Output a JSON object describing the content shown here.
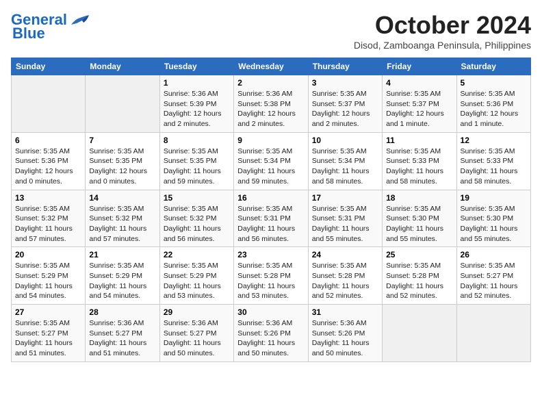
{
  "logo": {
    "general": "General",
    "blue": "Blue"
  },
  "title": "October 2024",
  "subtitle": "Disod, Zamboanga Peninsula, Philippines",
  "headers": [
    "Sunday",
    "Monday",
    "Tuesday",
    "Wednesday",
    "Thursday",
    "Friday",
    "Saturday"
  ],
  "weeks": [
    [
      {
        "day": "",
        "info": ""
      },
      {
        "day": "",
        "info": ""
      },
      {
        "day": "1",
        "info": "Sunrise: 5:36 AM\nSunset: 5:39 PM\nDaylight: 12 hours and 2 minutes."
      },
      {
        "day": "2",
        "info": "Sunrise: 5:36 AM\nSunset: 5:38 PM\nDaylight: 12 hours and 2 minutes."
      },
      {
        "day": "3",
        "info": "Sunrise: 5:35 AM\nSunset: 5:37 PM\nDaylight: 12 hours and 2 minutes."
      },
      {
        "day": "4",
        "info": "Sunrise: 5:35 AM\nSunset: 5:37 PM\nDaylight: 12 hours and 1 minute."
      },
      {
        "day": "5",
        "info": "Sunrise: 5:35 AM\nSunset: 5:36 PM\nDaylight: 12 hours and 1 minute."
      }
    ],
    [
      {
        "day": "6",
        "info": "Sunrise: 5:35 AM\nSunset: 5:36 PM\nDaylight: 12 hours and 0 minutes."
      },
      {
        "day": "7",
        "info": "Sunrise: 5:35 AM\nSunset: 5:35 PM\nDaylight: 12 hours and 0 minutes."
      },
      {
        "day": "8",
        "info": "Sunrise: 5:35 AM\nSunset: 5:35 PM\nDaylight: 11 hours and 59 minutes."
      },
      {
        "day": "9",
        "info": "Sunrise: 5:35 AM\nSunset: 5:34 PM\nDaylight: 11 hours and 59 minutes."
      },
      {
        "day": "10",
        "info": "Sunrise: 5:35 AM\nSunset: 5:34 PM\nDaylight: 11 hours and 58 minutes."
      },
      {
        "day": "11",
        "info": "Sunrise: 5:35 AM\nSunset: 5:33 PM\nDaylight: 11 hours and 58 minutes."
      },
      {
        "day": "12",
        "info": "Sunrise: 5:35 AM\nSunset: 5:33 PM\nDaylight: 11 hours and 58 minutes."
      }
    ],
    [
      {
        "day": "13",
        "info": "Sunrise: 5:35 AM\nSunset: 5:32 PM\nDaylight: 11 hours and 57 minutes."
      },
      {
        "day": "14",
        "info": "Sunrise: 5:35 AM\nSunset: 5:32 PM\nDaylight: 11 hours and 57 minutes."
      },
      {
        "day": "15",
        "info": "Sunrise: 5:35 AM\nSunset: 5:32 PM\nDaylight: 11 hours and 56 minutes."
      },
      {
        "day": "16",
        "info": "Sunrise: 5:35 AM\nSunset: 5:31 PM\nDaylight: 11 hours and 56 minutes."
      },
      {
        "day": "17",
        "info": "Sunrise: 5:35 AM\nSunset: 5:31 PM\nDaylight: 11 hours and 55 minutes."
      },
      {
        "day": "18",
        "info": "Sunrise: 5:35 AM\nSunset: 5:30 PM\nDaylight: 11 hours and 55 minutes."
      },
      {
        "day": "19",
        "info": "Sunrise: 5:35 AM\nSunset: 5:30 PM\nDaylight: 11 hours and 55 minutes."
      }
    ],
    [
      {
        "day": "20",
        "info": "Sunrise: 5:35 AM\nSunset: 5:29 PM\nDaylight: 11 hours and 54 minutes."
      },
      {
        "day": "21",
        "info": "Sunrise: 5:35 AM\nSunset: 5:29 PM\nDaylight: 11 hours and 54 minutes."
      },
      {
        "day": "22",
        "info": "Sunrise: 5:35 AM\nSunset: 5:29 PM\nDaylight: 11 hours and 53 minutes."
      },
      {
        "day": "23",
        "info": "Sunrise: 5:35 AM\nSunset: 5:28 PM\nDaylight: 11 hours and 53 minutes."
      },
      {
        "day": "24",
        "info": "Sunrise: 5:35 AM\nSunset: 5:28 PM\nDaylight: 11 hours and 52 minutes."
      },
      {
        "day": "25",
        "info": "Sunrise: 5:35 AM\nSunset: 5:28 PM\nDaylight: 11 hours and 52 minutes."
      },
      {
        "day": "26",
        "info": "Sunrise: 5:35 AM\nSunset: 5:27 PM\nDaylight: 11 hours and 52 minutes."
      }
    ],
    [
      {
        "day": "27",
        "info": "Sunrise: 5:35 AM\nSunset: 5:27 PM\nDaylight: 11 hours and 51 minutes."
      },
      {
        "day": "28",
        "info": "Sunrise: 5:36 AM\nSunset: 5:27 PM\nDaylight: 11 hours and 51 minutes."
      },
      {
        "day": "29",
        "info": "Sunrise: 5:36 AM\nSunset: 5:27 PM\nDaylight: 11 hours and 50 minutes."
      },
      {
        "day": "30",
        "info": "Sunrise: 5:36 AM\nSunset: 5:26 PM\nDaylight: 11 hours and 50 minutes."
      },
      {
        "day": "31",
        "info": "Sunrise: 5:36 AM\nSunset: 5:26 PM\nDaylight: 11 hours and 50 minutes."
      },
      {
        "day": "",
        "info": ""
      },
      {
        "day": "",
        "info": ""
      }
    ]
  ]
}
